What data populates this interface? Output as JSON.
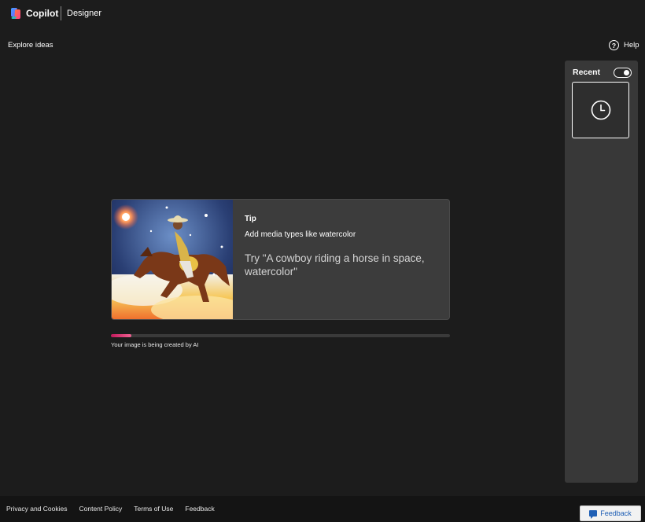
{
  "header": {
    "brand": "Copilot",
    "product": "Designer",
    "logo_icon": "copilot-logo-icon"
  },
  "nav": {
    "explore_label": "Explore ideas",
    "help_label": "Help",
    "help_icon": "question-circle-icon"
  },
  "recent": {
    "title": "Recent",
    "toggle_on": true,
    "thumb_icon": "clock-icon"
  },
  "tip": {
    "heading": "Tip",
    "text": "Add media types like watercolor",
    "example": "Try \"A cowboy riding a horse in space, watercolor\"",
    "image_icon": "cowboy-watercolor-image"
  },
  "progress": {
    "fraction": 0.06,
    "status": "Your image is being created by AI",
    "colors": [
      "#c2185b",
      "#f06292"
    ]
  },
  "footer": {
    "links": [
      "Privacy and Cookies",
      "Content Policy",
      "Terms of Use",
      "Feedback"
    ],
    "feedback_button": "Feedback"
  }
}
